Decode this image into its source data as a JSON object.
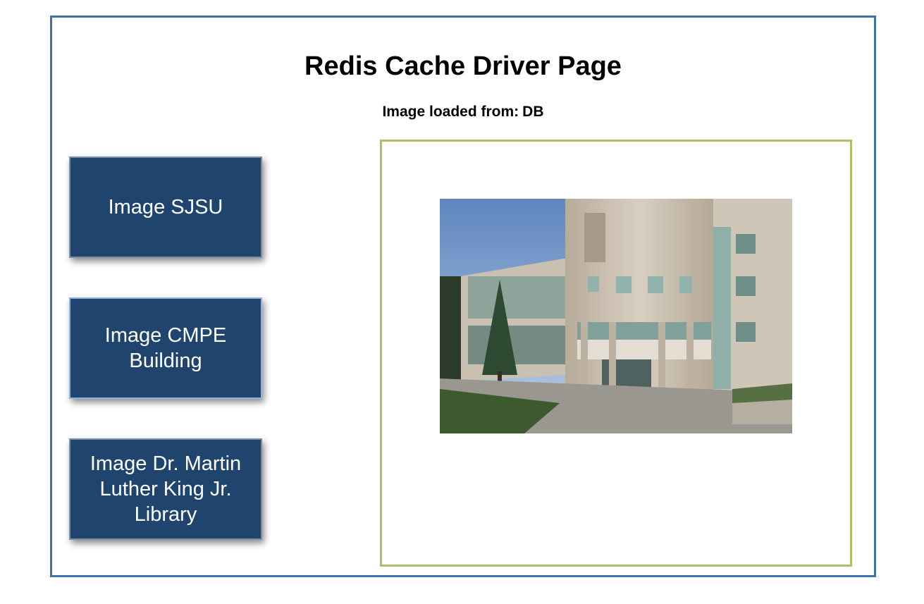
{
  "page": {
    "title": "Redis Cache Driver Page",
    "source_label": "Image loaded from:",
    "source_value": "DB"
  },
  "buttons": [
    {
      "label": "Image SJSU"
    },
    {
      "label": "Image CMPE Building"
    },
    {
      "label": "Image Dr. Martin Luther King Jr. Library"
    }
  ],
  "viewer": {
    "image_icon": "building-photo"
  },
  "colors": {
    "frame_border": "#3f72a8",
    "viewer_border": "#a8c26a",
    "button_bg": "#1f456e",
    "button_text": "#ffffff"
  }
}
